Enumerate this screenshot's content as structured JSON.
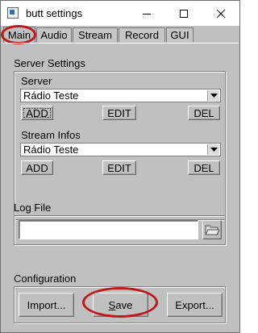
{
  "window": {
    "title": "butt settings",
    "controls": {
      "minimize": "minimize-icon",
      "maximize": "maximize-icon",
      "close": "close-icon"
    }
  },
  "tabs": [
    {
      "label": "Main",
      "active": true
    },
    {
      "label": "Audio"
    },
    {
      "label": "Stream"
    },
    {
      "label": "Record"
    },
    {
      "label": "GUI"
    }
  ],
  "server_settings": {
    "heading": "Server Settings",
    "server": {
      "label": "Server",
      "selected": "Rádio Teste",
      "add": "ADD",
      "edit": "EDIT",
      "del": "DEL"
    },
    "stream_infos": {
      "label": "Stream Infos",
      "selected": "Rádio Teste",
      "add": "ADD",
      "edit": "EDIT",
      "del": "DEL"
    }
  },
  "log_file": {
    "label": "Log File",
    "value": ""
  },
  "configuration": {
    "heading": "Configuration",
    "import": "Import...",
    "save_prefix": "",
    "save_mnemonic": "S",
    "save_rest": "ave",
    "export": "Export..."
  },
  "colors": {
    "highlight": "#c0171a",
    "background": "#c0c0c0"
  }
}
